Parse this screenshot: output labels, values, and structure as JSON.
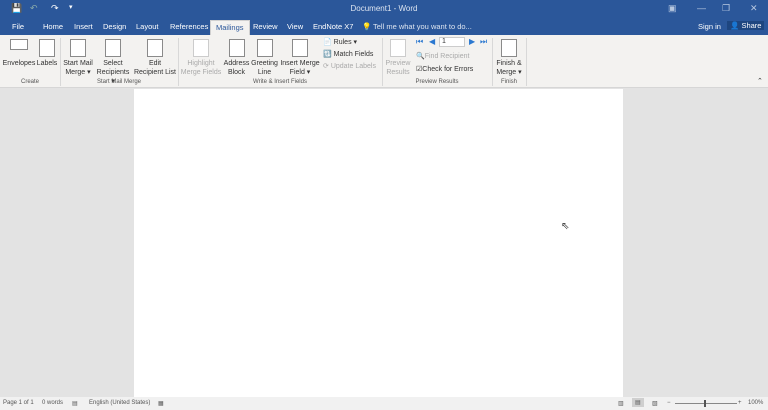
{
  "title": "Document1 - Word",
  "tabs": [
    "File",
    "Home",
    "Insert",
    "Design",
    "Layout",
    "References",
    "Mailings",
    "Review",
    "View",
    "EndNote X7"
  ],
  "active_tab": "Mailings",
  "tell_me": "Tell me what you want to do...",
  "sign_in": "Sign in",
  "share": "Share",
  "groups": {
    "create": "Create",
    "start": "Start Mail Merge",
    "write": "Write & Insert Fields",
    "preview": "Preview Results",
    "finish": "Finish"
  },
  "buttons": {
    "envelopes": "Envelopes",
    "labels": "Labels",
    "start1": "Start Mail",
    "start2": "Merge ▾",
    "select1": "Select",
    "select2": "Recipients ▾",
    "edit1": "Edit",
    "edit2": "Recipient List",
    "hl1": "Highlight",
    "hl2": "Merge Fields",
    "addr1": "Address",
    "addr2": "Block",
    "greet1": "Greeting",
    "greet2": "Line",
    "ins1": "Insert Merge",
    "ins2": "Field ▾",
    "rules": "Rules ▾",
    "match": "Match Fields",
    "update": "Update Labels",
    "prev1": "Preview",
    "prev2": "Results",
    "record": "1",
    "find": "Find Recipient",
    "check": "Check for Errors",
    "fin1": "Finish &",
    "fin2": "Merge ▾"
  },
  "status": {
    "page": "Page 1 of 1",
    "words": "0 words",
    "language": "English (United States)",
    "zoom": "100%"
  }
}
